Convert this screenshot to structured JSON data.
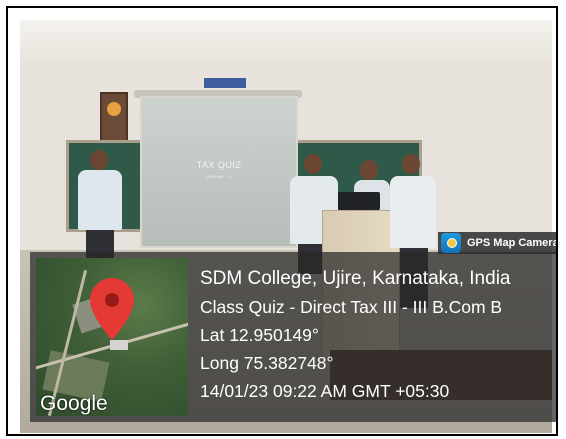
{
  "projector": {
    "title": "TAX QUIZ",
    "subtitle": "( ROUND - 1 )"
  },
  "badge": {
    "label": "GPS Map Camera",
    "icon": "gps-map-camera-icon"
  },
  "map": {
    "watermark": "Google",
    "pin_color": "#e53935"
  },
  "info": {
    "location": "SDM College, Ujire, Karnataka, India",
    "event": "Class Quiz - Direct Tax III - III B.Com B",
    "latitude": "Lat 12.950149°",
    "longitude": "Long 75.382748°",
    "datetime": "14/01/23 09:22 AM GMT +05:30"
  },
  "colors": {
    "overlay": "#282828",
    "text": "#ffffff",
    "chalkboard": "#2f5a4a"
  }
}
